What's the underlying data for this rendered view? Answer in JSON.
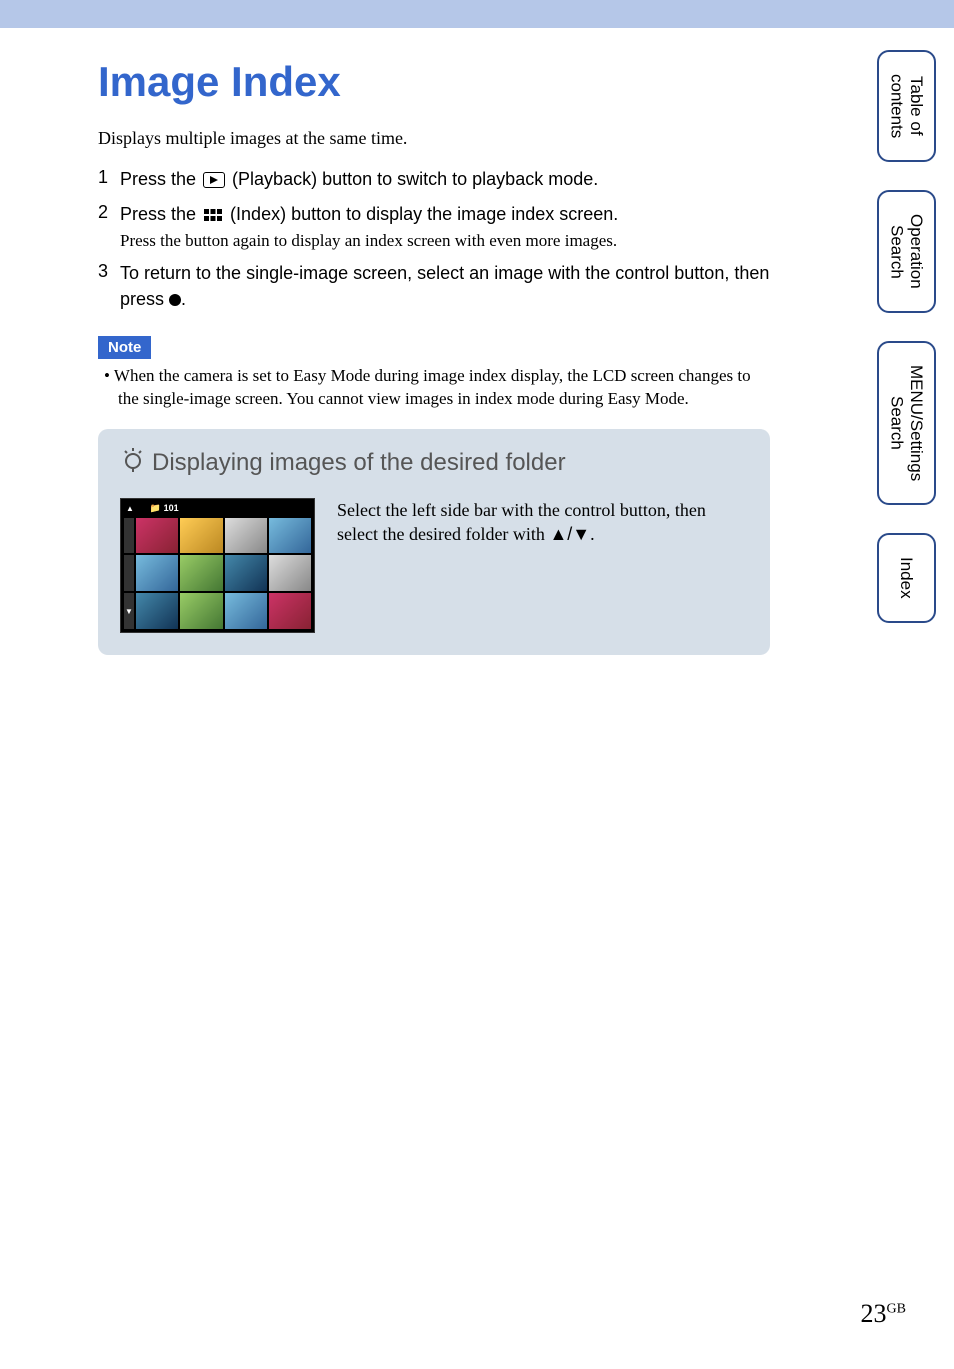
{
  "page": {
    "title": "Image Index",
    "intro": "Displays multiple images at the same time.",
    "page_number": "23",
    "page_suffix": "GB"
  },
  "steps": [
    {
      "num": "1",
      "prefix": "Press the ",
      "icon": "playback",
      "suffix": " (Playback) button to switch to playback mode."
    },
    {
      "num": "2",
      "prefix": "Press the ",
      "icon": "index",
      "suffix": " (Index) button to display the image index screen.",
      "sub": "Press the button again to display an index screen with even more images."
    },
    {
      "num": "3",
      "prefix": "To return to the single-image screen, select an image with the control button, then press ",
      "icon": "dot",
      "suffix": "."
    }
  ],
  "note": {
    "label": "Note",
    "text": "When the camera is set to Easy Mode during image index display, the LCD screen changes to the single-image screen. You cannot view images in index mode during Easy Mode."
  },
  "tip": {
    "title": "Displaying images of the desired folder",
    "folder_label": "101",
    "text_prefix": "Select the left side bar with the control button, then select the desired folder with ",
    "arrows": "▲/▼",
    "text_suffix": "."
  },
  "tabs": {
    "toc": "Table of\ncontents",
    "operation": "Operation\nSearch",
    "menu": "MENU/Settings\nSearch",
    "index": "Index"
  }
}
